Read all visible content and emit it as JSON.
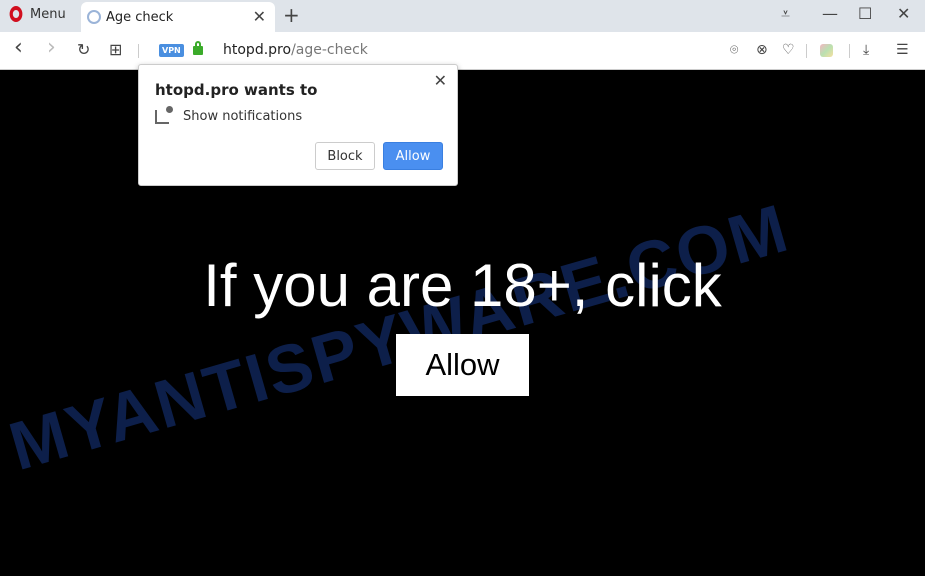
{
  "tabbar": {
    "menu_label": "Menu",
    "tab_title": "Age check",
    "new_tab": "+",
    "close_tab": "✕",
    "window": {
      "minimize": "—",
      "maximize": "☐",
      "close": "✕",
      "tab_menu": "⩡"
    }
  },
  "addressbar": {
    "back": "‹",
    "forward": "›",
    "reload": "↻",
    "speed_dial": "⊞",
    "vpn": "VPN",
    "url_host": "htopd.pro",
    "url_path": "/age-check",
    "icons": {
      "snapshot": "⌾",
      "adblock": "⊗",
      "heart": "♡",
      "download": "⤓",
      "settings": "☰"
    }
  },
  "popup": {
    "title": "htopd.pro wants to",
    "permission": "Show notifications",
    "block_label": "Block",
    "allow_label": "Allow",
    "close": "✕"
  },
  "page": {
    "headline": "If you are 18+, click",
    "allow_label": "Allow",
    "watermark": "MYANTISPYWARE.COM"
  },
  "colors": {
    "accent": "#4a8ff0",
    "lock": "#3bab2a",
    "opera": "#d10f1f"
  }
}
